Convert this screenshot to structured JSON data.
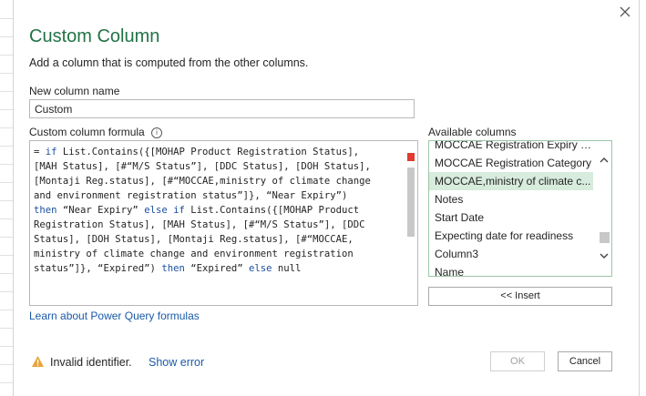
{
  "dialog": {
    "title": "Custom Column",
    "subtitle": "Add a column that is computed from the other columns.",
    "close_icon": "close-icon"
  },
  "new_column": {
    "label": "New column name",
    "value": "Custom"
  },
  "formula": {
    "label": "Custom column formula",
    "info_icon": "info-icon",
    "lines": [
      [
        "= ",
        "if",
        " List.Contains({[MOHAP Product Registration Status],"
      ],
      [
        "[MAH Status], [#“M/S Status”], [DDC Status], [DOH Status],"
      ],
      [
        "[Montaji Reg.status], [#“MOCCAE,ministry of climate change"
      ],
      [
        "and environment registration status”]}, “Near Expiry”)"
      ],
      [
        "then",
        " “Near Expiry” ",
        "else if",
        " List.Contains({[MOHAP Product"
      ],
      [
        "Registration Status], [MAH Status], [#“M/S Status”], [DDC"
      ],
      [
        "Status], [DOH Status], [Montaji Reg.status], [#“MOCCAE,"
      ],
      [
        "ministry of climate change and environment registration"
      ],
      [
        "status”]}, “Expired”) ",
        "then",
        " “Expired” ",
        "else",
        " null"
      ]
    ]
  },
  "learn_link": "Learn about Power Query formulas",
  "available_columns": {
    "label": "Available columns",
    "items": [
      "MOCCAE Registration Expiry D...",
      "MOCCAE Registration Category",
      "MOCCAE,ministry of climate c...",
      "Notes",
      "Start Date",
      "Expecting date for readiness",
      "Column3",
      "Name"
    ],
    "selected_index": 2
  },
  "buttons": {
    "insert": "<< Insert",
    "ok": "OK",
    "cancel": "Cancel"
  },
  "status": {
    "message": "Invalid identifier.",
    "show_error": "Show error",
    "icon": "warning-icon",
    "icon_color": "#e8a33a"
  },
  "colors": {
    "accent": "#217346",
    "link": "#1a5aa8",
    "selection": "#d7ecdc",
    "keyword": "#1a4fa0"
  }
}
